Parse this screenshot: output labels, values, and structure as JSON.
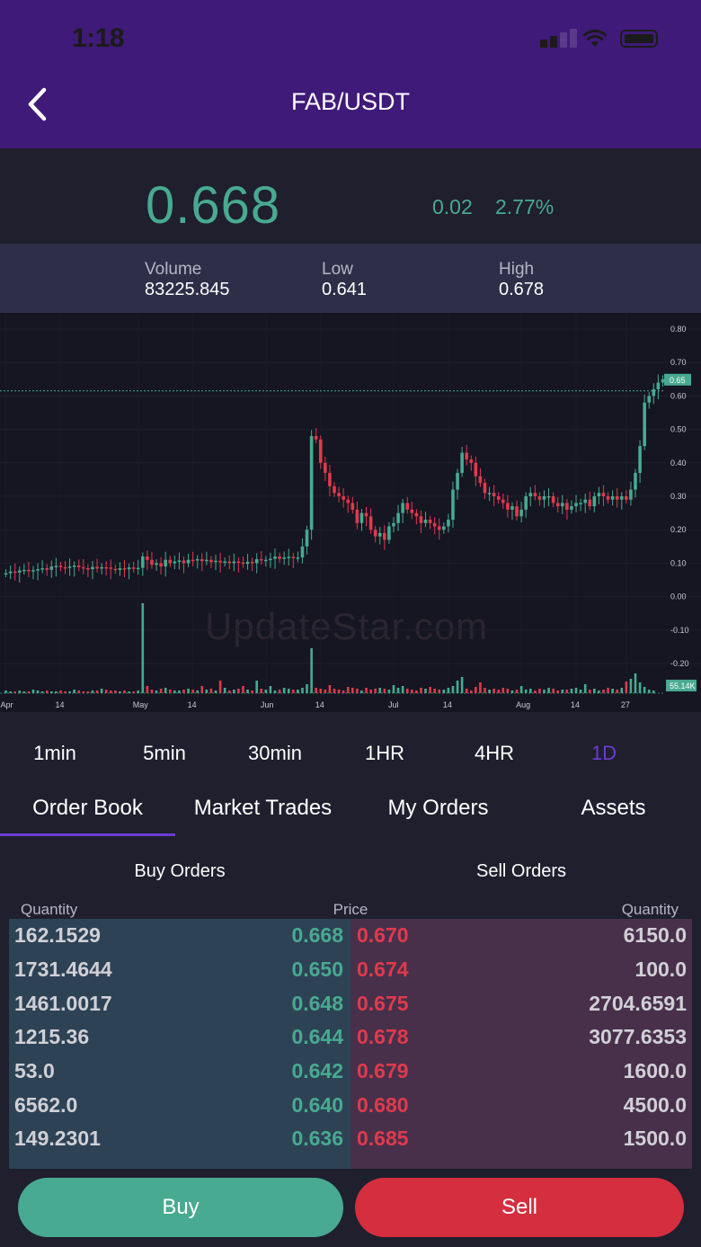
{
  "status_bar": {
    "time": "1:18"
  },
  "header": {
    "title": "FAB/USDT"
  },
  "ticker": {
    "price": "0.668",
    "change": "0.02",
    "change_pct": "2.77%",
    "volume_label": "Volume",
    "volume": "83225.845",
    "low_label": "Low",
    "low": "0.641",
    "high_label": "High",
    "high": "0.678",
    "up_color": "#48aa90",
    "down_color": "#e03a4c"
  },
  "chart_data": {
    "type": "candlestick",
    "watermark": "UpdateStar.com",
    "y_ticks": [
      "0.80",
      "0.70",
      "0.60",
      "0.50",
      "0.40",
      "0.30",
      "0.20",
      "0.10",
      "0.00",
      "-0.10",
      "-0.20"
    ],
    "y_tick_values": [
      0.8,
      0.7,
      0.6,
      0.5,
      0.4,
      0.3,
      0.2,
      0.1,
      0.0,
      -0.1,
      -0.2
    ],
    "price_tag": "0.65",
    "current_price": 0.65,
    "volume_tag": "55.14K",
    "x_ticks": [
      "Apr",
      "14",
      "May",
      "14",
      "Jun",
      "14",
      "Jul",
      "14",
      "Aug",
      "14",
      "27"
    ],
    "x_tick_index": [
      0,
      12,
      29,
      41,
      57,
      69,
      85,
      97,
      113,
      125,
      136
    ],
    "closes": [
      0.07,
      0.075,
      0.072,
      0.078,
      0.08,
      0.076,
      0.079,
      0.082,
      0.085,
      0.08,
      0.09,
      0.092,
      0.088,
      0.086,
      0.09,
      0.093,
      0.088,
      0.085,
      0.082,
      0.089,
      0.084,
      0.088,
      0.087,
      0.083,
      0.08,
      0.085,
      0.082,
      0.087,
      0.084,
      0.086,
      0.12,
      0.11,
      0.095,
      0.1,
      0.09,
      0.11,
      0.1,
      0.105,
      0.108,
      0.1,
      0.11,
      0.108,
      0.112,
      0.106,
      0.11,
      0.103,
      0.107,
      0.102,
      0.105,
      0.1,
      0.105,
      0.102,
      0.098,
      0.104,
      0.1,
      0.112,
      0.108,
      0.11,
      0.113,
      0.12,
      0.113,
      0.117,
      0.119,
      0.115,
      0.117,
      0.15,
      0.2,
      0.48,
      0.47,
      0.4,
      0.37,
      0.33,
      0.31,
      0.3,
      0.29,
      0.28,
      0.26,
      0.22,
      0.25,
      0.24,
      0.2,
      0.18,
      0.19,
      0.17,
      0.21,
      0.22,
      0.25,
      0.28,
      0.26,
      0.25,
      0.24,
      0.22,
      0.23,
      0.22,
      0.21,
      0.2,
      0.21,
      0.23,
      0.32,
      0.37,
      0.43,
      0.41,
      0.4,
      0.36,
      0.34,
      0.31,
      0.31,
      0.3,
      0.29,
      0.28,
      0.26,
      0.27,
      0.24,
      0.26,
      0.3,
      0.31,
      0.3,
      0.29,
      0.3,
      0.3,
      0.28,
      0.27,
      0.28,
      0.26,
      0.27,
      0.28,
      0.28,
      0.29,
      0.27,
      0.3,
      0.31,
      0.3,
      0.29,
      0.3,
      0.29,
      0.3,
      0.29,
      0.32,
      0.37,
      0.45,
      0.58,
      0.6,
      0.62,
      0.64,
      0.65
    ],
    "volumes": [
      3,
      2,
      2,
      3,
      2,
      2,
      4,
      3,
      2,
      3,
      2,
      2,
      3,
      2,
      2,
      4,
      3,
      2,
      2,
      3,
      3,
      5,
      4,
      3,
      3,
      2,
      3,
      2,
      2,
      3,
      100,
      8,
      4,
      3,
      5,
      6,
      4,
      3,
      3,
      4,
      5,
      4,
      3,
      8,
      4,
      5,
      3,
      14,
      6,
      3,
      4,
      5,
      8,
      4,
      3,
      14,
      5,
      4,
      8,
      3,
      4,
      6,
      5,
      4,
      4,
      6,
      10,
      50,
      6,
      5,
      4,
      9,
      5,
      4,
      3,
      7,
      6,
      5,
      3,
      6,
      4,
      5,
      6,
      5,
      4,
      9,
      6,
      8,
      5,
      4,
      3,
      6,
      5,
      7,
      5,
      4,
      4,
      6,
      8,
      14,
      18,
      5,
      3,
      7,
      12,
      6,
      4,
      5,
      4,
      6,
      5,
      3,
      4,
      8,
      4,
      5,
      3,
      5,
      4,
      6,
      5,
      3,
      4,
      4,
      5,
      6,
      4,
      10,
      4,
      5,
      3,
      4,
      6,
      5,
      4,
      6,
      13,
      16,
      22,
      12,
      7,
      4,
      3
    ]
  },
  "intervals": [
    {
      "label": "1min"
    },
    {
      "label": "5min"
    },
    {
      "label": "30min"
    },
    {
      "label": "1HR"
    },
    {
      "label": "4HR"
    },
    {
      "label": "1D"
    }
  ],
  "tabs": [
    {
      "label": "Order Book"
    },
    {
      "label": "Market Trades"
    },
    {
      "label": "My Orders"
    },
    {
      "label": "Assets"
    }
  ],
  "order_book": {
    "buy_title": "Buy Orders",
    "sell_title": "Sell Orders",
    "col_quantity": "Quantity",
    "col_price": "Price",
    "col_quantity_right": "Quantity",
    "rows": [
      {
        "buy_qty": "162.1529",
        "buy_price": "0.668",
        "sell_price": "0.670",
        "sell_qty": "6150.0"
      },
      {
        "buy_qty": "1731.4644",
        "buy_price": "0.650",
        "sell_price": "0.674",
        "sell_qty": "100.0"
      },
      {
        "buy_qty": "1461.0017",
        "buy_price": "0.648",
        "sell_price": "0.675",
        "sell_qty": "2704.6591"
      },
      {
        "buy_qty": "1215.36",
        "buy_price": "0.644",
        "sell_price": "0.678",
        "sell_qty": "3077.6353"
      },
      {
        "buy_qty": "53.0",
        "buy_price": "0.642",
        "sell_price": "0.679",
        "sell_qty": "1600.0"
      },
      {
        "buy_qty": "6562.0",
        "buy_price": "0.640",
        "sell_price": "0.680",
        "sell_qty": "4500.0"
      },
      {
        "buy_qty": "149.2301",
        "buy_price": "0.636",
        "sell_price": "0.685",
        "sell_qty": "1500.0"
      }
    ]
  },
  "actions": {
    "buy": "Buy",
    "sell": "Sell"
  }
}
